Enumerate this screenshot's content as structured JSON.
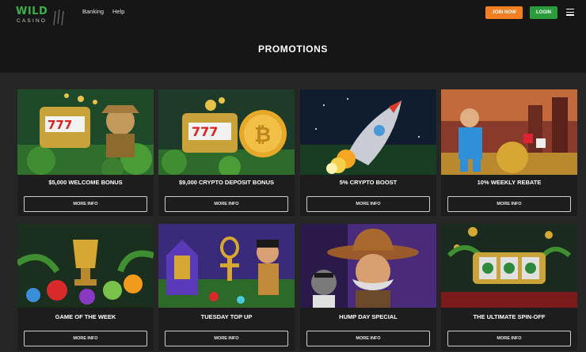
{
  "header": {
    "logo_top": "WILD",
    "logo_bottom": "CASINO",
    "nav_banking": "Banking",
    "nav_help": "Help",
    "join_label": "JOIN NOW",
    "login_label": "LOGIN",
    "menu_icon": "hamburger-menu-icon"
  },
  "page_title": "PROMOTIONS",
  "promotions": [
    {
      "title": "$5,000 WELCOME BONUS",
      "button": "MORE INFO",
      "image": "explorer-slot-machine-image"
    },
    {
      "title": "$9,000 CRYPTO DEPOSIT BONUS",
      "button": "MORE INFO",
      "image": "slot-machine-bitcoin-image"
    },
    {
      "title": "5% CRYPTO BOOST",
      "button": "MORE INFO",
      "image": "rocket-launch-image"
    },
    {
      "title": "10% WEEKLY REBATE",
      "button": "MORE INFO",
      "image": "superhero-cash-image"
    },
    {
      "title": "GAME OF THE WEEK",
      "button": "MORE INFO",
      "image": "jungle-fruit-trophy-image"
    },
    {
      "title": "TUESDAY TOP UP",
      "button": "MORE INFO",
      "image": "egyptian-queen-image"
    },
    {
      "title": "HUMP DAY SPECIAL",
      "button": "MORE INFO",
      "image": "cowboy-character-image"
    },
    {
      "title": "THE ULTIMATE SPIN-OFF",
      "button": "MORE INFO",
      "image": "gold-slot-reels-image"
    }
  ],
  "colors": {
    "brand_green": "#3db047",
    "join_orange": "#f47f20",
    "login_green": "#2a9d3a"
  }
}
